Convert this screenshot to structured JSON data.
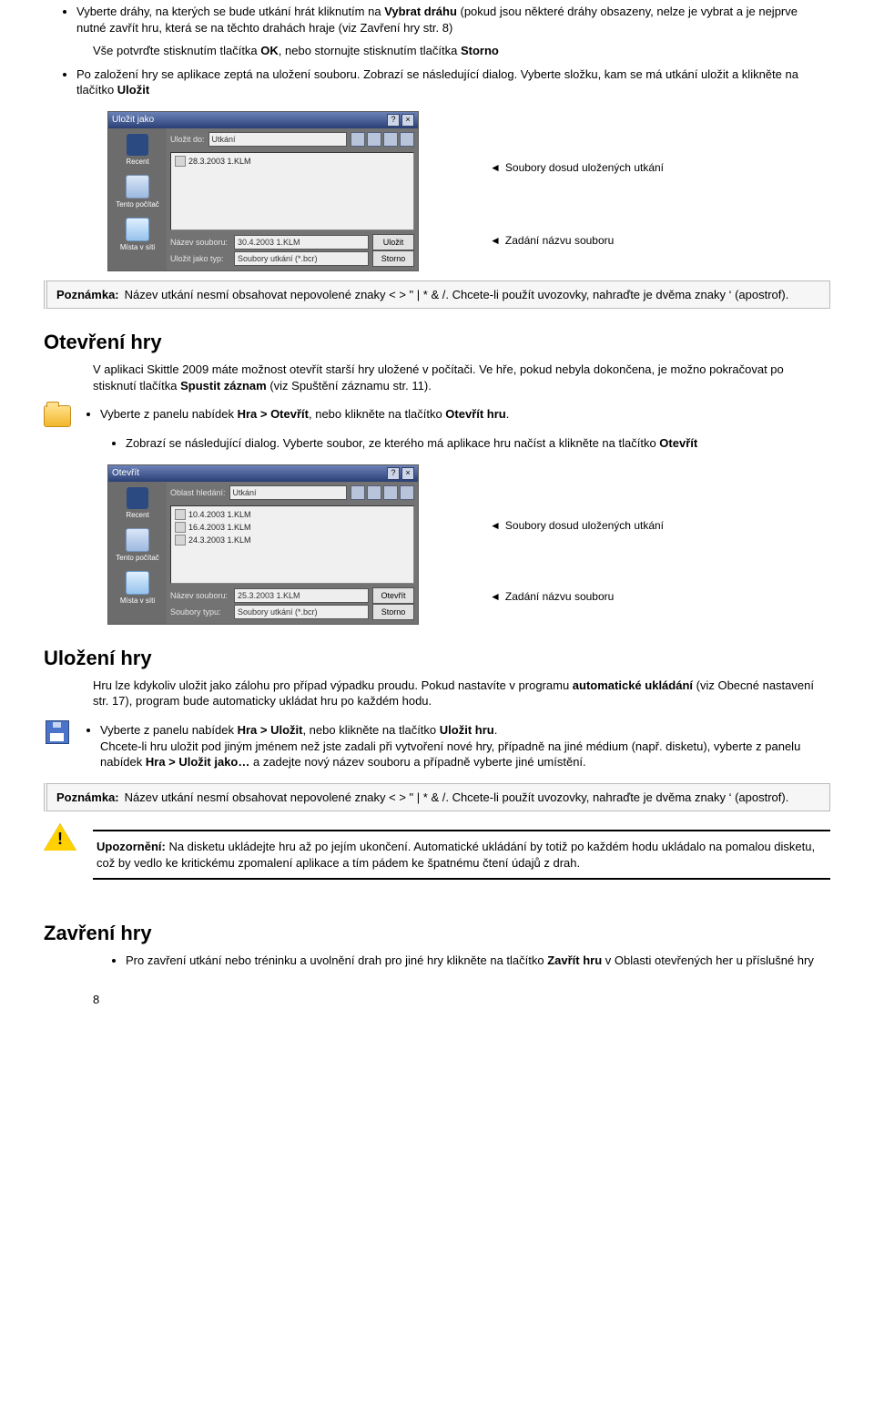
{
  "intro": {
    "bullet1_a": "Vyberte dráhy, na kterých se bude utkání hrát kliknutím na ",
    "bullet1_b": "Vybrat dráhu",
    "bullet1_c": "  (pokud jsou některé dráhy obsazeny, nelze je vybrat a je nejprve nutné zavřít hru, která se na těchto drahách hraje (viz Zavření hry str. 8)",
    "line2_a": "Vše potvrďte stisknutím tlačítka ",
    "line2_b": "OK",
    "line2_c": ", nebo stornujte stisknutím tlačítka ",
    "line2_d": "Storno",
    "bullet2_a": "Po založení hry se aplikace zeptá na uložení souboru. Zobrazí se následující dialog. Vyberte složku, kam se má utkání uložit a klikněte na tlačítko ",
    "bullet2_b": "Uložit"
  },
  "dialog_save": {
    "title": "Uložit jako",
    "lookin_label": "Uložit do:",
    "lookin_value": "Utkání",
    "files": [
      "28.3.2003 1.KLM"
    ],
    "name_label": "Název souboru:",
    "name_value": "30.4.2003 1.KLM",
    "type_label": "Uložit jako typ:",
    "type_value": "Soubory utkání (*.bcr)",
    "btn_primary": "Uložit",
    "btn_secondary": "Storno",
    "side": {
      "recent": "Recent",
      "pc": "Tento počítač",
      "net": "Místa v síti"
    }
  },
  "annot": {
    "files": "Soubory dosud uložených utkání",
    "name": "Zadání názvu souboru"
  },
  "note": {
    "label": "Poznámka:",
    "text": "Název utkání nesmí obsahovat nepovolené znaky < > \" | * & /. Chcete-li použít uvozovky, nahraďte je dvěma znaky ‘ (apostrof)."
  },
  "open": {
    "heading": "Otevření hry",
    "p1_a": "V aplikaci Skittle 2009 máte možnost otevřít starší hry uložené v počítači. Ve hře, pokud nebyla dokončena, je možno pokračovat po stisknutí tlačítka ",
    "p1_b": "Spustit záznam",
    "p1_c": " (viz Spuštění záznamu str. 11).",
    "b1_a": "Vyberte z panelu nabídek ",
    "b1_b": "Hra > Otevřít",
    "b1_c": ", nebo klikněte na tlačítko ",
    "b1_d": "Otevřít hru",
    "b1_e": ".",
    "b2_a": "Zobrazí se následující dialog. Vyberte soubor, ze kterého má aplikace hru načíst a klikněte na tlačítko ",
    "b2_b": "Otevřít"
  },
  "dialog_open": {
    "title": "Otevřít",
    "lookin_label": "Oblast hledání:",
    "lookin_value": "Utkání",
    "files": [
      "10.4.2003 1.KLM",
      "16.4.2003 1.KLM",
      "24.3.2003 1.KLM"
    ],
    "name_label": "Název souboru:",
    "name_value": "25.3.2003 1.KLM",
    "type_label": "Soubory typu:",
    "type_value": "Soubory utkání (*.bcr)",
    "btn_primary": "Otevřít",
    "btn_secondary": "Storno"
  },
  "save": {
    "heading": "Uložení hry",
    "p1_a": "Hru lze kdykoliv uložit jako zálohu pro případ výpadku proudu. Pokud nastavíte v programu ",
    "p1_b": "automatické ukládání",
    "p1_c": " (viz Obecné nastavení str. 17), program bude automaticky ukládat hru po každém hodu.",
    "b1_a": "Vyberte z panelu nabídek ",
    "b1_b": "Hra > Uložit",
    "b1_c": ", nebo klikněte na tlačítko ",
    "b1_d": "Uložit hru",
    "b1_e": ".",
    "b1_f": "Chcete-li hru uložit pod jiným jménem než jste zadali při vytvoření nové hry, případně na jiné médium (např. disketu), vyberte z panelu nabídek ",
    "b1_g": "Hra > Uložit jako…",
    "b1_h": " a zadejte nový název souboru a případně vyberte jiné umístění."
  },
  "warn": {
    "label": "Upozornění:",
    "text": " Na disketu ukládejte hru až po jejím ukončení. Automatické ukládání by totiž po každém hodu ukládalo na pomalou disketu, což by vedlo ke kritickému zpomalení aplikace a tím pádem ke špatnému čtení údajů z drah."
  },
  "close": {
    "heading": "Zavření hry",
    "b1_a": "Pro zavření utkání nebo tréninku a uvolnění drah pro jiné hry klikněte na tlačítko ",
    "b1_b": "Zavřít hru",
    "b1_c": " v Oblasti otevřených her u příslušné hry"
  },
  "page_number": "8"
}
